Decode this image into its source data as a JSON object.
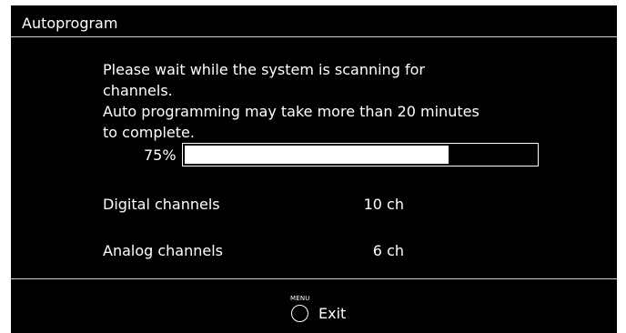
{
  "dialog": {
    "title": "Autoprogram"
  },
  "message": {
    "lines": [
      "Please wait while the system is scanning for",
      "channels.",
      "Auto programming may take more than 20 minutes",
      "to complete."
    ]
  },
  "progress": {
    "label": "75%",
    "value": 0.75
  },
  "channels": {
    "digital": {
      "label": "Digital channels",
      "value": "10 ch"
    },
    "analog": {
      "label": "Analog channels",
      "value": "6 ch"
    }
  },
  "footer": {
    "button_label": "MENU",
    "action_label": "Exit",
    "icon": "circle-button-icon"
  },
  "colors": {
    "background": "#000000",
    "text": "#ffffff",
    "divider": "#cfcfcf"
  }
}
